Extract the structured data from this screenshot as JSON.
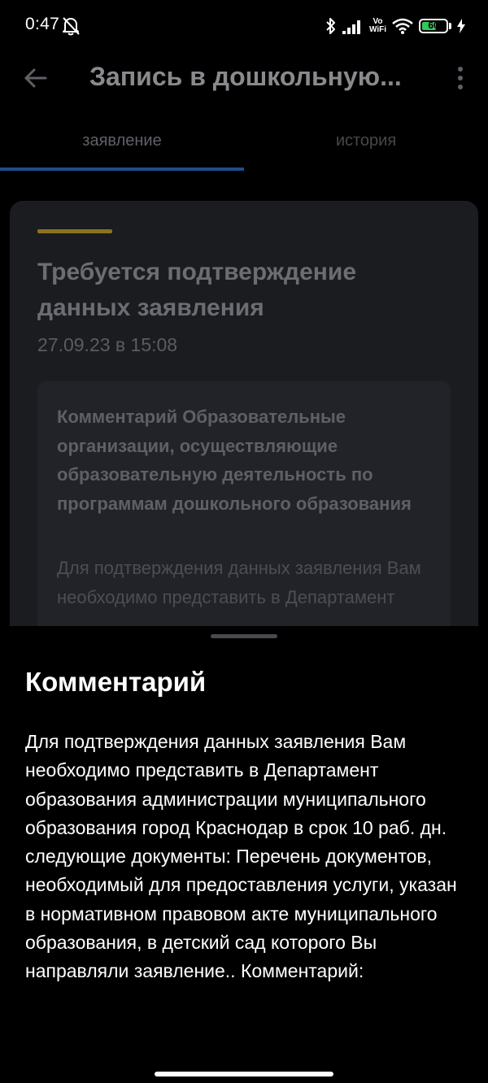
{
  "status_bar": {
    "time": "0:47",
    "vowifi_top": "Vo",
    "vowifi_bottom": "WiFi",
    "battery_level": "60"
  },
  "app_bar": {
    "title": "Запись в дошкольную..."
  },
  "tabs": [
    {
      "label": "заявление",
      "active": true
    },
    {
      "label": "история",
      "active": false
    }
  ],
  "card": {
    "title": "Требуется подтверждение данных заявления",
    "date": "27.09.23 в 15:08",
    "comment_heading": "Комментарий Образовательные организации, осуществляющие образовательную деятельность по программам дошкольного образования",
    "comment_preview": "Для подтверждения данных заявления Вам необходимо представить в Департамент"
  },
  "sheet": {
    "title": "Комментарий",
    "text": "Для подтверждения данных заявления Вам необходимо представить в Департамент образования администрации муниципального образования город Краснодар в срок 10 раб. дн. следующие документы: Перечень документов, необходимый для предоставления услуги, указан в нормативном правовом акте муниципального образования, в детский сад которого Вы направляли заявление.. Комментарий:"
  },
  "colors": {
    "accent_tab": "#1e4e8c",
    "accent_status": "#8a7320",
    "battery": "#34c759"
  }
}
